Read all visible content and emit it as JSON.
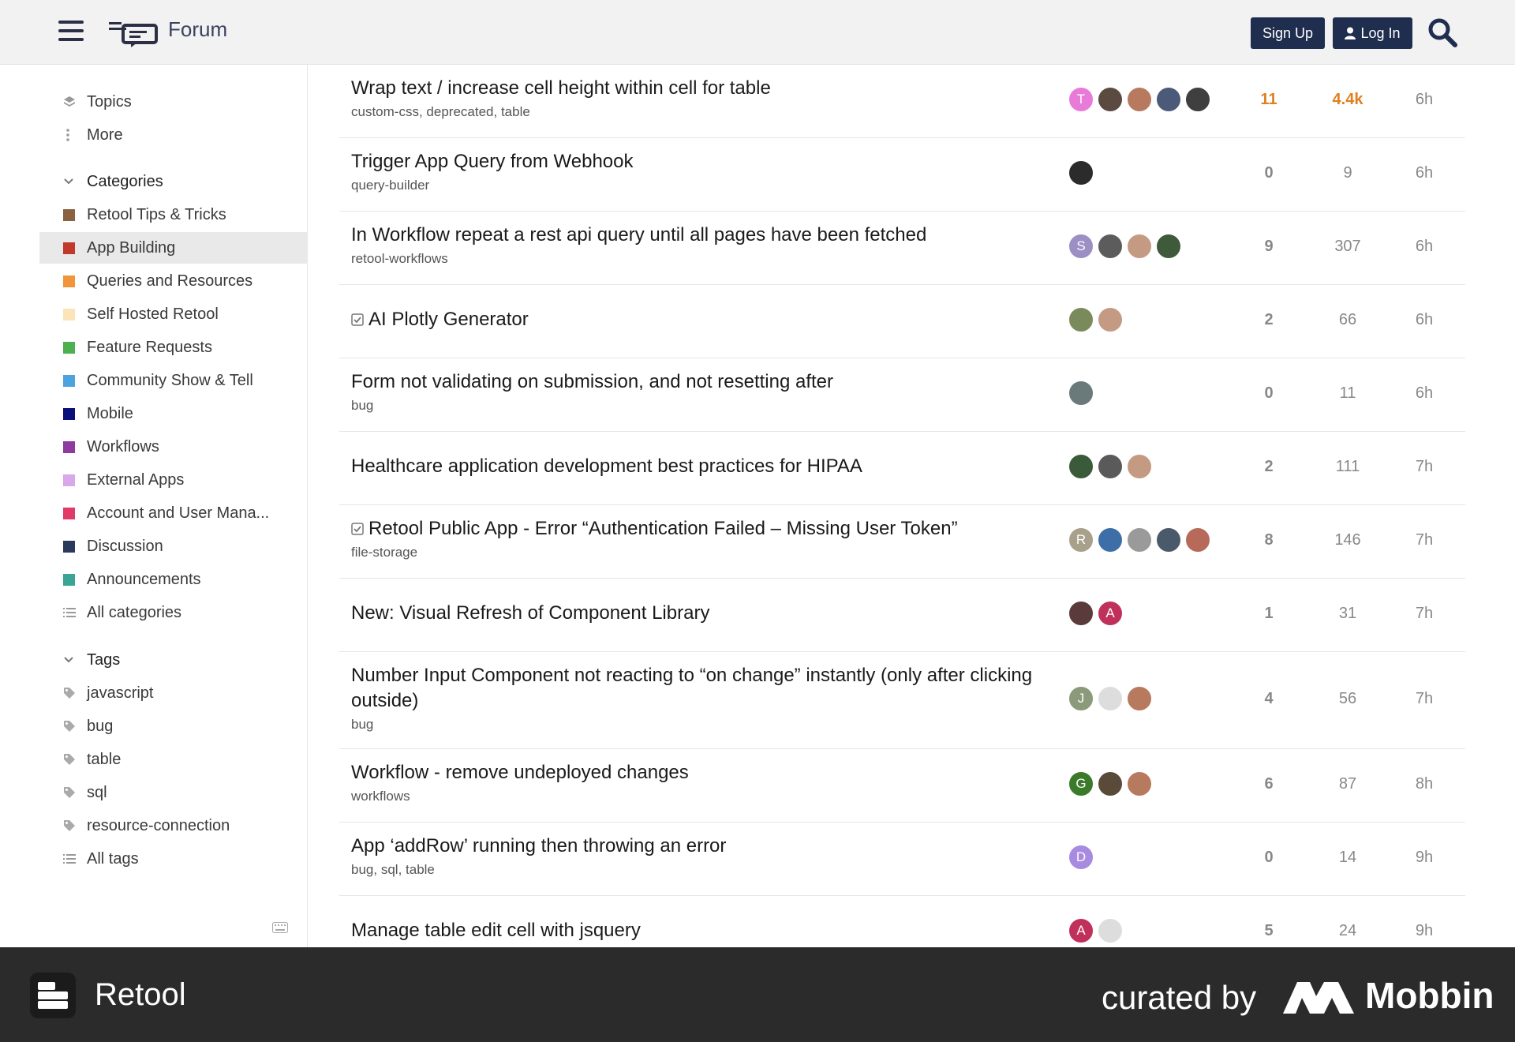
{
  "header": {
    "title": "Forum",
    "signup_label": "Sign Up",
    "login_label": "Log In"
  },
  "sidebar": {
    "topics_label": "Topics",
    "more_label": "More",
    "categories_heading": "Categories",
    "categories": [
      {
        "label": "Retool Tips & Tricks",
        "color": "#8a6240"
      },
      {
        "label": "App Building",
        "color": "#c0392b"
      },
      {
        "label": "Queries and Resources",
        "color": "#f0953a"
      },
      {
        "label": "Self Hosted Retool",
        "color": "#fbe5b8"
      },
      {
        "label": "Feature Requests",
        "color": "#4caf50"
      },
      {
        "label": "Community Show & Tell",
        "color": "#4da3e0"
      },
      {
        "label": "Mobile",
        "color": "#0b0f7a"
      },
      {
        "label": "Workflows",
        "color": "#8e3a9e"
      },
      {
        "label": "External Apps",
        "color": "#d8a8e8"
      },
      {
        "label": "Account and User Mana...",
        "color": "#e0396a"
      },
      {
        "label": "Discussion",
        "color": "#2b3a5c"
      },
      {
        "label": "Announcements",
        "color": "#3aa594"
      }
    ],
    "all_categories_label": "All categories",
    "tags_heading": "Tags",
    "tags": [
      "javascript",
      "bug",
      "table",
      "sql",
      "resource-connection"
    ],
    "all_tags_label": "All tags"
  },
  "topics": [
    {
      "title": "Wrap text / increase cell height within cell for table",
      "tags": [
        "custom-css",
        "deprecated",
        "table"
      ],
      "replies": "11",
      "views": "4.4k",
      "activity": "6h",
      "hot": true,
      "posters": [
        {
          "letter": "T",
          "color": "#e87ad8"
        },
        {
          "letter": "",
          "color": "#5a4a3f"
        },
        {
          "letter": "",
          "color": "#b77a5e"
        },
        {
          "letter": "",
          "color": "#4a5a78"
        },
        {
          "letter": "",
          "color": "#3f3f3f"
        }
      ]
    },
    {
      "title": "Trigger App Query from Webhook",
      "tags": [
        "query-builder"
      ],
      "replies": "0",
      "views": "9",
      "activity": "6h",
      "posters": [
        {
          "letter": "",
          "color": "#2b2b2b"
        }
      ]
    },
    {
      "title": "In Workflow repeat a rest api query until all pages have been fetched",
      "tags": [
        "retool-workflows"
      ],
      "replies": "9",
      "views": "307",
      "activity": "6h",
      "posters": [
        {
          "letter": "S",
          "color": "#9b8fc4"
        },
        {
          "letter": "",
          "color": "#5c5c5c"
        },
        {
          "letter": "",
          "color": "#c49a82"
        },
        {
          "letter": "",
          "color": "#3e5a3a"
        }
      ]
    },
    {
      "title": "AI Plotly Generator",
      "tags": [],
      "solved": true,
      "replies": "2",
      "views": "66",
      "activity": "6h",
      "posters": [
        {
          "letter": "",
          "color": "#7a8a5a"
        },
        {
          "letter": "",
          "color": "#c49a82"
        }
      ]
    },
    {
      "title": "Form not validating on submission, and not resetting after",
      "tags": [
        "bug"
      ],
      "replies": "0",
      "views": "11",
      "activity": "6h",
      "posters": [
        {
          "letter": "",
          "color": "#6a7a7a"
        }
      ]
    },
    {
      "title": "Healthcare application development best practices for HIPAA",
      "tags": [],
      "replies": "2",
      "views": "111",
      "activity": "7h",
      "posters": [
        {
          "letter": "",
          "color": "#3a5a3a"
        },
        {
          "letter": "",
          "color": "#5a5a5a"
        },
        {
          "letter": "",
          "color": "#c49a82"
        }
      ]
    },
    {
      "title": "Retool Public App - Error “Authentication Failed – Missing User Token”",
      "tags": [
        "file-storage"
      ],
      "solved": true,
      "replies": "8",
      "views": "146",
      "activity": "7h",
      "posters": [
        {
          "letter": "R",
          "color": "#a8a08a"
        },
        {
          "letter": "",
          "color": "#3d6ea8"
        },
        {
          "letter": "",
          "color": "#9a9a9a"
        },
        {
          "letter": "",
          "color": "#4a5a6a"
        },
        {
          "letter": "",
          "color": "#b86a5a"
        }
      ]
    },
    {
      "title": "New: Visual Refresh of Component Library",
      "tags": [],
      "replies": "1",
      "views": "31",
      "activity": "7h",
      "posters": [
        {
          "letter": "",
          "color": "#5a3a3a"
        },
        {
          "letter": "A",
          "color": "#c0305a"
        }
      ]
    },
    {
      "title": "Number Input Component not reacting to “on change” instantly (only after clicking outside)",
      "tags": [
        "bug"
      ],
      "replies": "4",
      "views": "56",
      "activity": "7h",
      "posters": [
        {
          "letter": "J",
          "color": "#8a9a7a"
        },
        {
          "letter": "",
          "color": "#dddddd"
        },
        {
          "letter": "",
          "color": "#b77a5e"
        }
      ]
    },
    {
      "title": "Workflow - remove undeployed changes",
      "tags": [
        "workflows"
      ],
      "replies": "6",
      "views": "87",
      "activity": "8h",
      "posters": [
        {
          "letter": "G",
          "color": "#3a7a2a"
        },
        {
          "letter": "",
          "color": "#5a4a3a"
        },
        {
          "letter": "",
          "color": "#b77a5e"
        }
      ]
    },
    {
      "title": "App ‘addRow’ running then throwing an error",
      "tags": [
        "bug",
        "sql",
        "table"
      ],
      "replies": "0",
      "views": "14",
      "activity": "9h",
      "posters": [
        {
          "letter": "D",
          "color": "#a88ae0"
        }
      ]
    },
    {
      "title": "Manage table edit cell with jsquery",
      "tags": [],
      "replies": "5",
      "views": "24",
      "activity": "9h",
      "posters": [
        {
          "letter": "A",
          "color": "#c0305a"
        },
        {
          "letter": "",
          "color": "#dddddd"
        }
      ]
    }
  ],
  "footer": {
    "brand": "Retool",
    "curated_by": "curated by",
    "curator": "Mobbin"
  }
}
